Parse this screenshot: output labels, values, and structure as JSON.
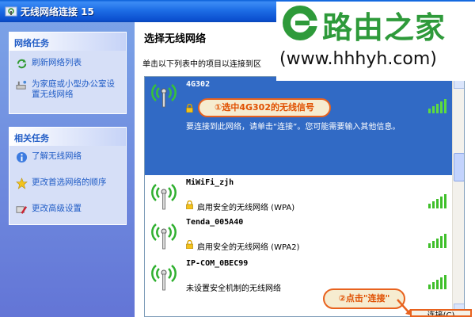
{
  "window": {
    "title": "无线网络连接 15"
  },
  "watermark": {
    "brand": "路由之家",
    "url": "(www.hhhyh.com)"
  },
  "left_pane": {
    "network_tasks": {
      "heading": "网络任务",
      "items": [
        {
          "label": "刷新网络列表",
          "icon": "refresh-icon"
        },
        {
          "label": "为家庭或小型办公室设置无线网络",
          "icon": "setup-network-icon"
        }
      ]
    },
    "related_tasks": {
      "heading": "相关任务",
      "items": [
        {
          "label": "了解无线网络",
          "icon": "info-icon"
        },
        {
          "label": "更改首选网络的顺序",
          "icon": "star-icon"
        },
        {
          "label": "更改高级设置",
          "icon": "settings-icon"
        }
      ]
    }
  },
  "main": {
    "title": "选择无线网络",
    "description": "单击以下列表中的项目以连接到区",
    "networks": [
      {
        "name": "4G302",
        "status": "",
        "hint": "要连接到此网络，请单击“连接”。您可能需要输入其他信息。",
        "secured": true,
        "selected": true,
        "signal_bars": 5
      },
      {
        "name": "MiWiFi_zjh",
        "status": "启用安全的无线网络 (WPA)",
        "secured": true,
        "selected": false,
        "signal_bars": 5
      },
      {
        "name": "Tenda_005A40",
        "status": "启用安全的无线网络 (WPA2)",
        "secured": true,
        "selected": false,
        "signal_bars": 5
      },
      {
        "name": "IP-COM_0BEC99",
        "status": "未设置安全机制的无线网络",
        "secured": false,
        "selected": false,
        "signal_bars": 5
      }
    ],
    "connect_button": "连接(C)"
  },
  "annotations": {
    "step1": "①选中4G302的无线信号",
    "step2": "②点击\"连接\""
  },
  "colors": {
    "accent": "#316ac5",
    "callout_border": "#e8621e",
    "brand_green": "#2e9a3a"
  }
}
